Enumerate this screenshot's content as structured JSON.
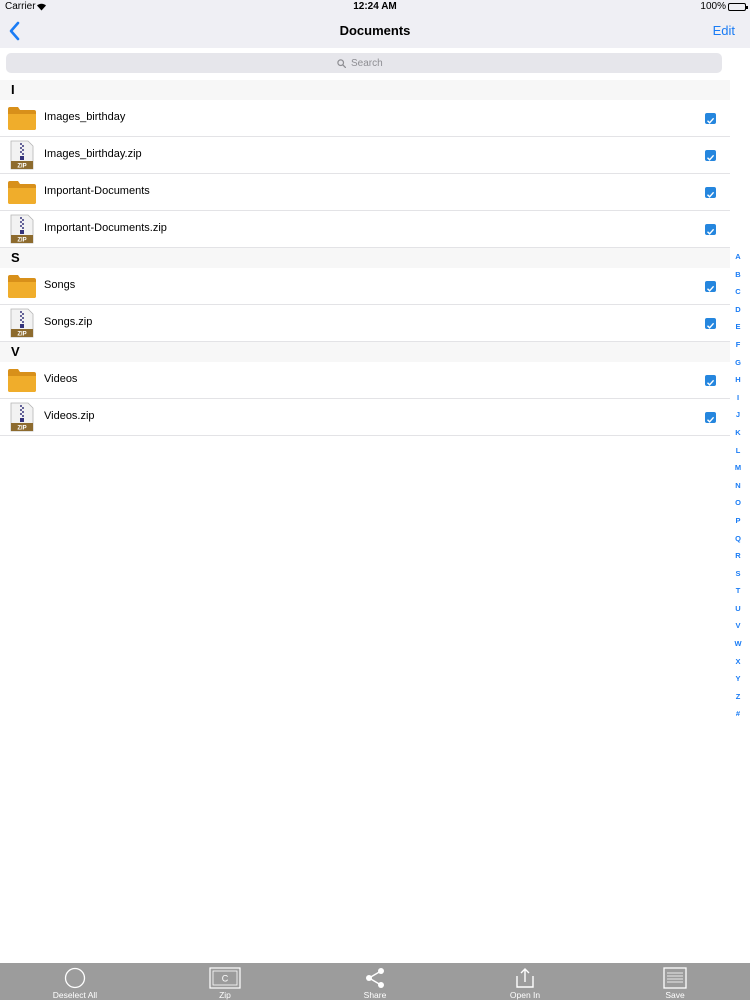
{
  "status": {
    "carrier": "Carrier",
    "time": "12:24 AM",
    "battery": "100%"
  },
  "nav": {
    "title": "Documents",
    "edit_label": "Edit"
  },
  "search": {
    "placeholder": "Search"
  },
  "sections": [
    {
      "letter": "I",
      "items": [
        {
          "name": "Images_birthday",
          "kind": "folder",
          "checked": true
        },
        {
          "name": "Images_birthday.zip",
          "kind": "zip",
          "checked": true
        },
        {
          "name": "Important-Documents",
          "kind": "folder",
          "checked": true
        },
        {
          "name": "Important-Documents.zip",
          "kind": "zip",
          "checked": true
        }
      ]
    },
    {
      "letter": "S",
      "items": [
        {
          "name": "Songs",
          "kind": "folder",
          "checked": true
        },
        {
          "name": "Songs.zip",
          "kind": "zip",
          "checked": true
        }
      ]
    },
    {
      "letter": "V",
      "items": [
        {
          "name": "Videos",
          "kind": "folder",
          "checked": true
        },
        {
          "name": "Videos.zip",
          "kind": "zip",
          "checked": true
        }
      ]
    }
  ],
  "zip_badge": "ZIP",
  "index_letters": [
    "A",
    "B",
    "C",
    "D",
    "E",
    "F",
    "G",
    "H",
    "I",
    "J",
    "K",
    "L",
    "M",
    "N",
    "O",
    "P",
    "Q",
    "R",
    "S",
    "T",
    "U",
    "V",
    "W",
    "X",
    "Y",
    "Z",
    "#"
  ],
  "toolbar": {
    "deselect_all": "Deselect All",
    "zip": "Zip",
    "share": "Share",
    "open_in": "Open In",
    "save": "Save"
  },
  "colors": {
    "accent": "#1a7cf5",
    "checkbox": "#2586de",
    "folder": "#e6a421",
    "toolbar": "#9c9c9c"
  }
}
